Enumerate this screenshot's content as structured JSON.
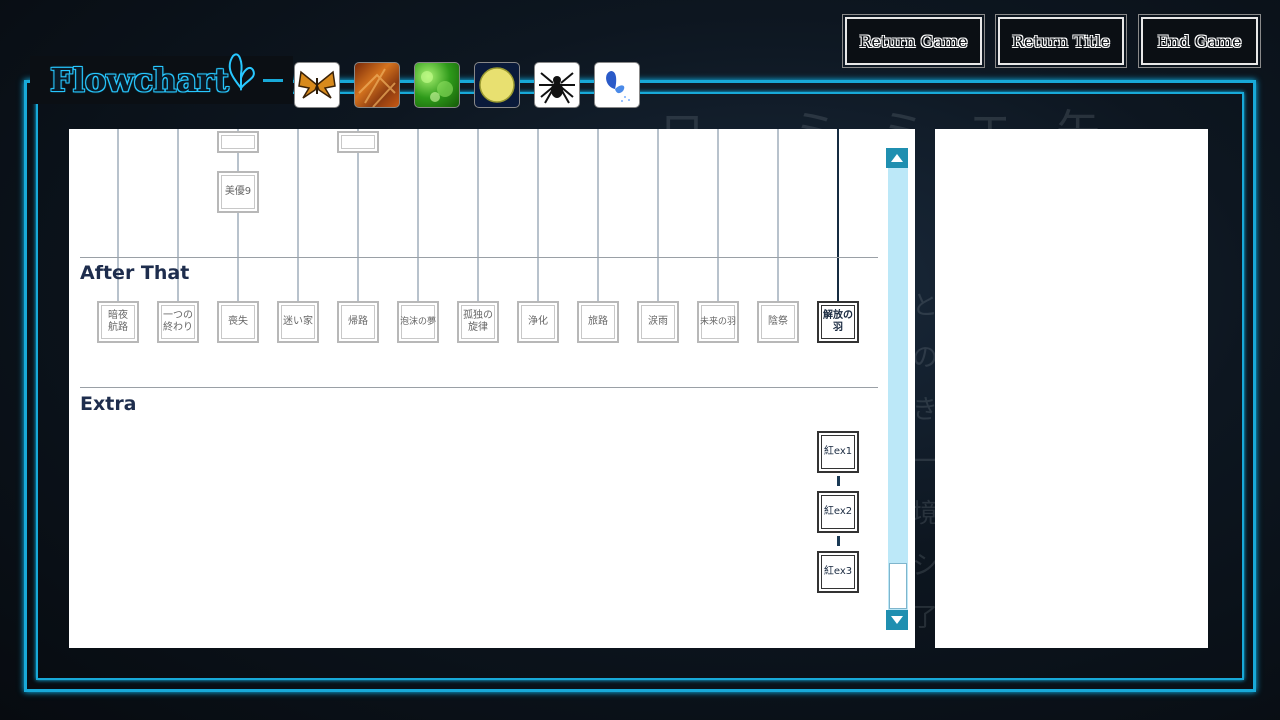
{
  "header": {
    "title": "Flowchart",
    "buttons": [
      "Return Game",
      "Return Title",
      "End Game"
    ]
  },
  "tabs": [
    {
      "icon": "moth-icon"
    },
    {
      "icon": "autumn-leaf-icon"
    },
    {
      "icon": "green-leaves-icon"
    },
    {
      "icon": "moon-icon"
    },
    {
      "icon": "spider-icon"
    },
    {
      "icon": "blue-butterfly-icon"
    }
  ],
  "flowchart": {
    "top_nodes": [
      "美優9"
    ],
    "sections": {
      "after_that": "After That",
      "extra": "Extra"
    },
    "after_that_nodes": [
      "暗夜\n航路",
      "一つの\n終わり",
      "喪失",
      "迷い家",
      "帰路",
      "泡沫の夢",
      "孤独の\n旋律",
      "浄化",
      "旅路",
      "涙雨",
      "未来の羽",
      "陰祭",
      "解放の羽"
    ],
    "extra_nodes": [
      "紅ex1",
      "紅ex2",
      "紅ex3"
    ]
  },
  "colors": {
    "accent": "#18a9d8",
    "scroll_track": "#bce8f8",
    "section_title": "#1e2d4d"
  }
}
